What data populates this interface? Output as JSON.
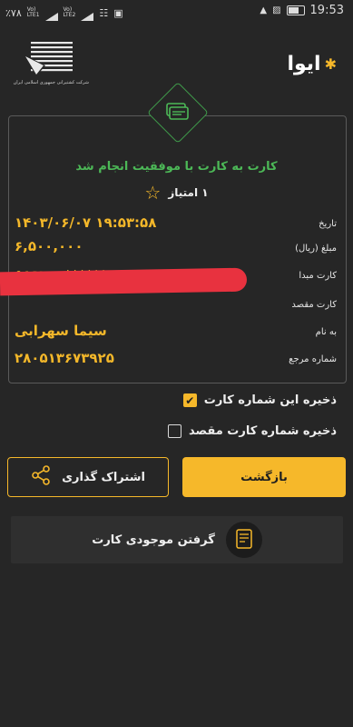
{
  "status_bar": {
    "left_items": [
      "٪۷۸",
      "Vo)) LTE1",
      "Vo)) LTE2"
    ],
    "time": "19:53"
  },
  "header": {
    "org_caption": "شرکت کشتیرانی جمهوری اسلامی ایران",
    "app_logo": "ایوا"
  },
  "receipt": {
    "success_title": "کارت به کارت با موفقیت انجام شد",
    "score_label": "۱ امتیاز",
    "rows": [
      {
        "label": "تاریخ",
        "value": "۱۴۰۳/۰۶/۰۷ ۱۹:۵۳:۵۸"
      },
      {
        "label": "مبلغ (ریال)",
        "value": "۶,۵۰۰,۰۰۰"
      },
      {
        "label": "کارت مبدا",
        "value": "۵۸۹۲۱۰******۱۰۲۵"
      },
      {
        "label": "کارت مقصد",
        "value": ""
      },
      {
        "label": "به نام",
        "value": "سیما سهرابی"
      },
      {
        "label": "شماره مرجع",
        "value": "۲۸۰۵۱۳۶۷۳۹۲۵"
      }
    ]
  },
  "options": {
    "save_card": {
      "label": "ذخیره این شماره کارت",
      "checked": true
    },
    "save_dest": {
      "label": "ذخیره شماره کارت مقصد",
      "checked": false
    }
  },
  "buttons": {
    "back": "بازگشت",
    "share": "اشتراک گذاری",
    "balance": "گرفتن موجودی کارت"
  },
  "colors": {
    "background": "#262626",
    "accent": "#f6b82a",
    "success": "#4cb857"
  }
}
